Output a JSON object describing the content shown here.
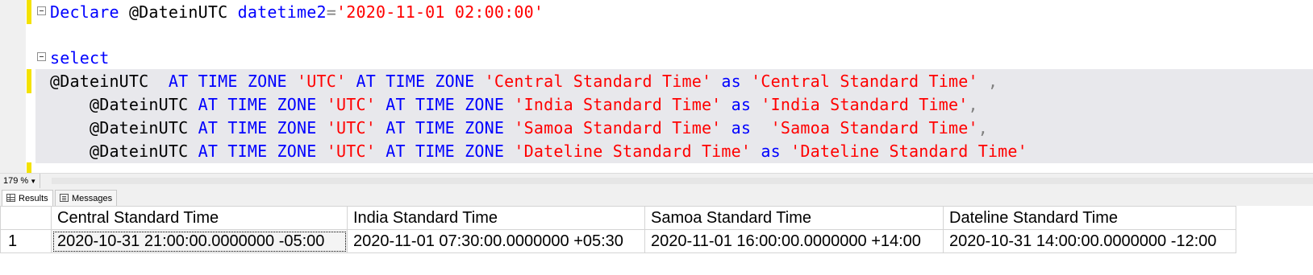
{
  "editor": {
    "lines": [
      [
        {
          "c": "kw",
          "t": "Declare "
        },
        {
          "c": "id",
          "t": "@DateinUTC "
        },
        {
          "c": "kw",
          "t": "datetime2"
        },
        {
          "c": "gy",
          "t": "="
        },
        {
          "c": "st",
          "t": "'2020-11-01 02:00:00'"
        }
      ],
      [],
      [
        {
          "c": "kw",
          "t": "select"
        }
      ],
      [
        {
          "c": "id",
          "t": "@DateinUTC  "
        },
        {
          "c": "kw",
          "t": "AT TIME ZONE "
        },
        {
          "c": "st",
          "t": "'UTC'"
        },
        {
          "c": "kw",
          "t": " AT TIME ZONE "
        },
        {
          "c": "st",
          "t": "'Central Standard Time'"
        },
        {
          "c": "kw",
          "t": " as "
        },
        {
          "c": "st",
          "t": "'Central Standard Time'"
        },
        {
          "c": "gy",
          "t": " ,"
        }
      ],
      [
        {
          "c": "id",
          "t": "    @DateinUTC "
        },
        {
          "c": "kw",
          "t": "AT TIME ZONE "
        },
        {
          "c": "st",
          "t": "'UTC'"
        },
        {
          "c": "kw",
          "t": " AT TIME ZONE "
        },
        {
          "c": "st",
          "t": "'India Standard Time'"
        },
        {
          "c": "kw",
          "t": " as "
        },
        {
          "c": "st",
          "t": "'India Standard Time'"
        },
        {
          "c": "gy",
          "t": ","
        }
      ],
      [
        {
          "c": "id",
          "t": "    @DateinUTC "
        },
        {
          "c": "kw",
          "t": "AT TIME ZONE "
        },
        {
          "c": "st",
          "t": "'UTC'"
        },
        {
          "c": "kw",
          "t": " AT TIME ZONE "
        },
        {
          "c": "st",
          "t": "'Samoa Standard Time'"
        },
        {
          "c": "kw",
          "t": " as  "
        },
        {
          "c": "st",
          "t": "'Samoa Standard Time'"
        },
        {
          "c": "gy",
          "t": ","
        }
      ],
      [
        {
          "c": "id",
          "t": "    @DateinUTC "
        },
        {
          "c": "kw",
          "t": "AT TIME ZONE "
        },
        {
          "c": "st",
          "t": "'UTC'"
        },
        {
          "c": "kw",
          "t": " AT TIME ZONE "
        },
        {
          "c": "st",
          "t": "'Dateline Standard Time'"
        },
        {
          "c": "kw",
          "t": " as "
        },
        {
          "c": "st",
          "t": "'Dateline Standard Time'"
        }
      ]
    ]
  },
  "status": {
    "zoom": "179 %"
  },
  "tabs": {
    "results_label": "Results",
    "messages_label": "Messages"
  },
  "results": {
    "columns": [
      "Central Standard Time",
      "India Standard Time",
      "Samoa Standard Time",
      "Dateline Standard Time"
    ],
    "rows": [
      {
        "num": "1",
        "cells": [
          "2020-10-31 21:00:00.0000000 -05:00",
          "2020-11-01 07:30:00.0000000 +05:30",
          "2020-11-01 16:00:00.0000000 +14:00",
          "2020-10-31 14:00:00.0000000 -12:00"
        ]
      }
    ]
  },
  "colors": {
    "keyword": "#0000ff",
    "string": "#ff0000",
    "change_marker": "#f4e200"
  }
}
